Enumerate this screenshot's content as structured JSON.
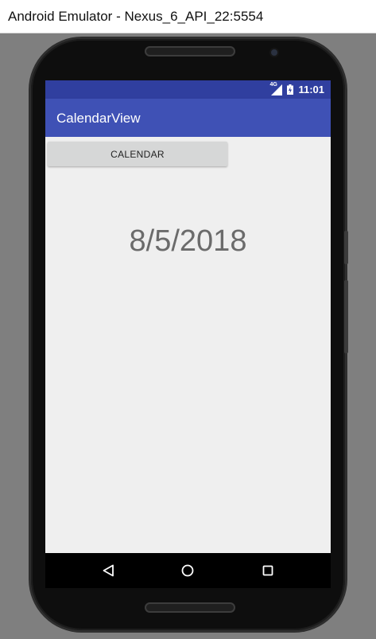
{
  "window": {
    "title": "Android Emulator - Nexus_6_API_22:5554"
  },
  "status_bar": {
    "network_label": "4G",
    "time": "11:01",
    "icons": [
      "signal-icon",
      "battery-icon"
    ]
  },
  "app_bar": {
    "title": "CalendarView"
  },
  "main": {
    "calendar_button_label": "CALENDAR",
    "selected_date": "8/5/2018"
  },
  "nav_bar": {
    "icons": [
      "back-icon",
      "home-icon",
      "recents-icon"
    ]
  },
  "colors": {
    "status_bar": "#303f9f",
    "app_bar": "#3f51b5",
    "content_background": "#efefef",
    "button_background": "#d6d7d7",
    "date_text": "#6b6b6b"
  }
}
